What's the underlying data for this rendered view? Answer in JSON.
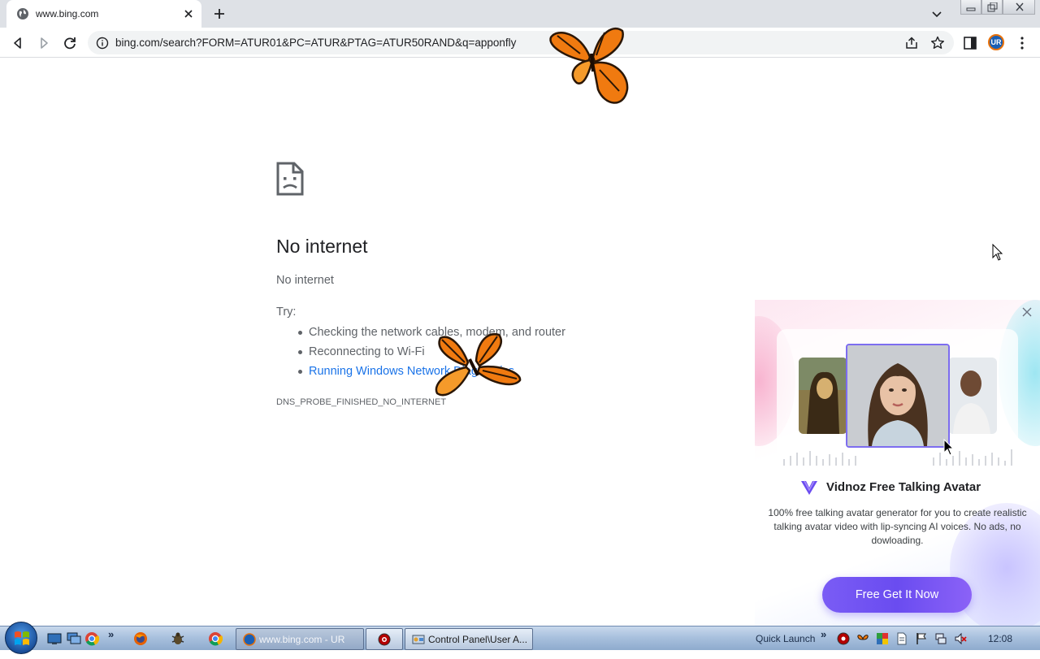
{
  "browser": {
    "tab": {
      "title": "www.bing.com"
    },
    "url": "bing.com/search?FORM=ATUR01&PC=ATUR&PTAG=ATUR50RAND&q=apponfly",
    "profile_initials": "UR"
  },
  "error_page": {
    "title": "No internet",
    "subtitle": "No internet",
    "try_label": "Try:",
    "suggestions": [
      "Checking the network cables, modem, and router",
      "Reconnecting to Wi-Fi",
      "Running Windows Network Diagnostics"
    ],
    "error_code": "DNS_PROBE_FINISHED_NO_INTERNET"
  },
  "ad": {
    "brand": "Vidnoz Free Talking Avatar",
    "description": "100% free talking avatar generator for you to create realistic talking avatar video with lip-syncing AI voices. No ads, no dowloading.",
    "cta": "Free Get It Now"
  },
  "taskbar": {
    "tasks": [
      {
        "label": "www.bing.com - UR"
      },
      {
        "label": "Control Panel\\User A..."
      }
    ],
    "quick_launch": "Quick Launch",
    "clock": "12:08"
  },
  "colors": {
    "link": "#1a73e8",
    "ad_accent": "#6a4cf0",
    "butterfly": "#f07a10"
  }
}
